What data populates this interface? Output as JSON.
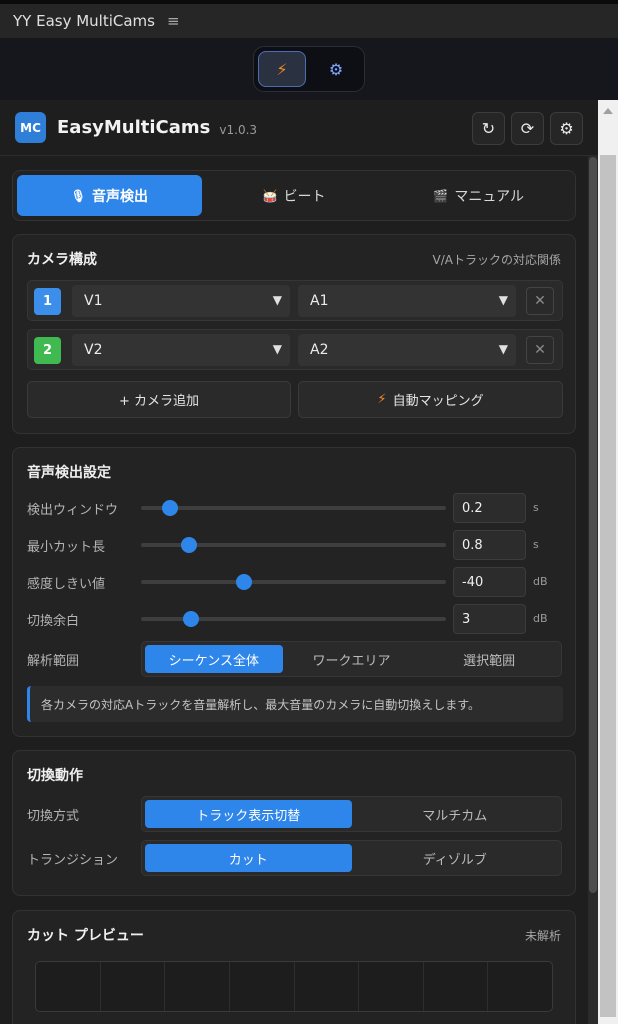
{
  "window": {
    "title": "YY Easy MultiCams",
    "menu_icon": "≡"
  },
  "toolbar": {
    "bolt_icon": "⚡",
    "gear_icon": "⚙"
  },
  "header": {
    "logo": "MC",
    "app_name": "EasyMultiCams",
    "version": "v1.0.3",
    "buttons": [
      {
        "name": "undo",
        "glyph": "↻"
      },
      {
        "name": "refresh",
        "glyph": "⟳"
      },
      {
        "name": "settings",
        "glyph": "⚙"
      }
    ]
  },
  "modes": {
    "items": [
      {
        "icon": "🎙",
        "label": "音声検出",
        "active": true
      },
      {
        "icon": "🥁",
        "label": "ビート",
        "active": false
      },
      {
        "icon": "🎬",
        "label": "マニュアル",
        "active": false
      }
    ]
  },
  "camera": {
    "title": "カメラ構成",
    "note": "V/Aトラックの対応関係",
    "rows": [
      {
        "num": "1",
        "color": "#3b8eea",
        "video": "V1",
        "audio": "A1"
      },
      {
        "num": "2",
        "color": "#3fb950",
        "video": "V2",
        "audio": "A2"
      }
    ],
    "add_label": "+ カメラ追加",
    "auto_label": "自動マッピング",
    "auto_icon": "⚡"
  },
  "detect": {
    "title": "音声検出設定",
    "sliders": [
      {
        "label": "検出ウィンドウ",
        "value": "0.2",
        "unit": "s",
        "pos": 0.094
      },
      {
        "label": "最小カット長",
        "value": "0.8",
        "unit": "s",
        "pos": 0.157
      },
      {
        "label": "感度しきい値",
        "value": "-40",
        "unit": "dB",
        "pos": 0.338
      },
      {
        "label": "切換余白",
        "value": "3",
        "unit": "dB",
        "pos": 0.164
      }
    ],
    "range_label": "解析範囲",
    "range_options": [
      "シーケンス全体",
      "ワークエリア",
      "選択範囲"
    ],
    "info": "各カメラの対応Aトラックを音量解析し、最大音量のカメラに自動切換えします。"
  },
  "switch": {
    "title": "切換動作",
    "method_label": "切換方式",
    "method_options": [
      "トラック表示切替",
      "マルチカム"
    ],
    "transition_label": "トランジション",
    "transition_options": [
      "カット",
      "ディゾルブ"
    ]
  },
  "preview": {
    "title": "カット プレビュー",
    "status": "未解析"
  },
  "accent": "#2f86ea"
}
